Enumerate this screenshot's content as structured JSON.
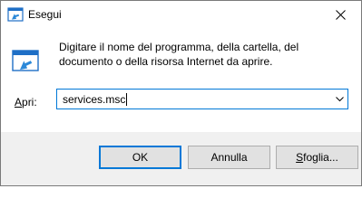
{
  "window": {
    "title": "Esegui"
  },
  "content": {
    "description_line1": "Digitare il nome del programma, della cartella, del",
    "description_line2": "documento o della risorsa Internet da aprire."
  },
  "open_field": {
    "label_accel": "A",
    "label_rest": "pri:",
    "value": "services.msc"
  },
  "buttons": {
    "ok": "OK",
    "cancel": "Annulla",
    "browse_accel": "S",
    "browse_rest": "foglia..."
  },
  "colors": {
    "accent": "#0078d7",
    "footer_bg": "#f0f0f0"
  }
}
